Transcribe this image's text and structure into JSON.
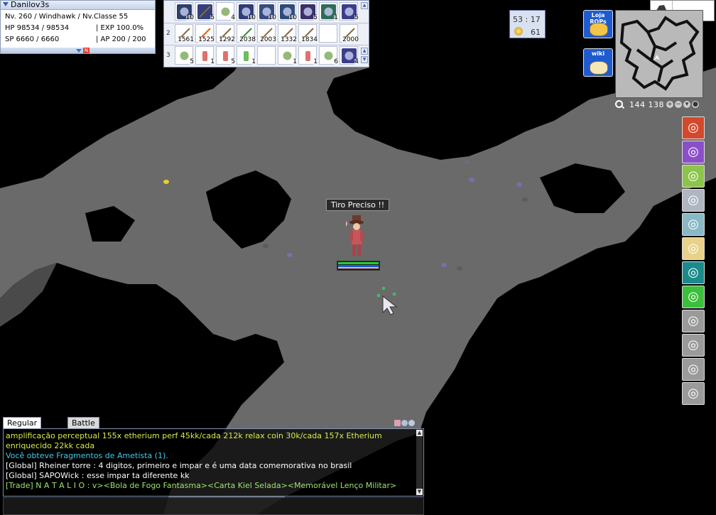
{
  "status": {
    "name": "Danilov3s",
    "level_line": "Nv. 260 / Windhawk / Nv.Classe 55",
    "hp": "HP 98534 / 98534",
    "exp": "| EXP 100.0%",
    "sp": "SP 6660 / 6660",
    "ap": "| AP 200 / 200",
    "badge": "N"
  },
  "hotkeys": {
    "rows": [
      {
        "num": "",
        "slots": [
          {
            "icon": "thunder-skill-icon",
            "color": "#2d3f6b",
            "count": "10"
          },
          {
            "icon": "arrow-skill-icon",
            "color": "#34407a",
            "count": "5"
          },
          {
            "icon": "stone-icon",
            "color": "#fff",
            "count": "4"
          },
          {
            "icon": "eye-skill-icon",
            "color": "#2f3c75",
            "count": "10"
          },
          {
            "icon": "ghost-skill-icon",
            "color": "#364c80",
            "count": "10"
          },
          {
            "icon": "trap-skill-icon",
            "color": "#2d4a78",
            "count": "10"
          },
          {
            "icon": "blade-skill-icon",
            "color": "#3a2f6b",
            "count": "5"
          },
          {
            "icon": "wind-skill-icon",
            "color": "#2f6b58",
            "count": "1"
          },
          {
            "icon": "storm-skill-icon",
            "color": "#3b3d8a",
            "count": "5"
          }
        ]
      },
      {
        "num": "2",
        "slots": [
          {
            "icon": "arrow-item-icon",
            "color": "#fff",
            "count": "1561"
          },
          {
            "icon": "fire-arrow-icon",
            "color": "#fff",
            "count": "1525"
          },
          {
            "icon": "arrow-item-icon",
            "color": "#fff",
            "count": "1292"
          },
          {
            "icon": "green-arrow-icon",
            "color": "#fff",
            "count": "2038"
          },
          {
            "icon": "arrow-item-icon",
            "color": "#fff",
            "count": "2003"
          },
          {
            "icon": "arrow-item-icon",
            "color": "#fff",
            "count": "1332"
          },
          {
            "icon": "arrow-item-icon",
            "color": "#fff",
            "count": "1834"
          },
          {
            "icon": "",
            "color": "#fff",
            "count": ""
          },
          {
            "icon": "arrow-item-icon",
            "color": "#fff",
            "count": "2000"
          }
        ]
      },
      {
        "num": "3",
        "slots": [
          {
            "icon": "leaf-icon",
            "color": "#fff",
            "count": "5"
          },
          {
            "icon": "potion-icon",
            "color": "#fff",
            "count": "1"
          },
          {
            "icon": "potion-icon",
            "color": "#fff",
            "count": "5"
          },
          {
            "icon": "flask-icon",
            "color": "#fff",
            "count": "1"
          },
          {
            "icon": "",
            "color": "#fff",
            "count": ""
          },
          {
            "icon": "clover-icon",
            "color": "#fff",
            "count": "1"
          },
          {
            "icon": "potion-icon",
            "color": "#fff",
            "count": "1"
          },
          {
            "icon": "fruit-icon",
            "color": "#fff",
            "count": "6"
          },
          {
            "icon": "book-icon",
            "color": "#3b3d8a",
            "count": "4"
          }
        ]
      }
    ]
  },
  "timebox": {
    "time": "53 : 17",
    "coins": "61"
  },
  "buttons": {
    "loja": "Loja ROPs",
    "wiki": "wiki"
  },
  "eqslot": {
    "count": "4"
  },
  "coords": {
    "xy": "144  138"
  },
  "overlay": {
    "skill_call": "Tiro Preciso !!"
  },
  "chat": {
    "tab_regular": "Regular Chat",
    "tab_battle": "Battle Log",
    "lines": [
      {
        "text": "amplificação perceptual 155x etherium perf 45kk/cada 212k relax coin 30k/cada 157x Etherium",
        "color": "#d9e94b"
      },
      {
        "text": "enriquecido 22kk cada",
        "color": "#d9e94b"
      },
      {
        "text": "Você obteve Fragmentos de Ametista (1).",
        "color": "#44c9e8"
      },
      {
        "text": "[Global] Rheiner torre : 4 digitos, primeiro e impar e é uma data comemorativa no brasil",
        "color": "#ffffff"
      },
      {
        "text": "[Global] SAPOWick : esse impar ta diferente kk",
        "color": "#ffffff"
      },
      {
        "text": "[Trade] N A T A L I O : v><Bola de Fogo Fantasma><Carta Kiel Selada><Memorável Lenço Militar>",
        "color": "#9fe36b"
      }
    ]
  },
  "skills_right": [
    {
      "icon": "fire-spiral-skill-icon",
      "color": "#d4482c"
    },
    {
      "icon": "purple-spiral-skill-icon",
      "color": "#8a4fc8"
    },
    {
      "icon": "green-swirl-skill-icon",
      "color": "#8dc44c"
    },
    {
      "icon": "white-swirl-skill-icon",
      "color": "#b0b6c0"
    },
    {
      "icon": "teal-swirl-skill-icon",
      "color": "#8ab8c4"
    },
    {
      "icon": "light-skill-icon",
      "color": "#e8d28a"
    },
    {
      "icon": "cross-arrows-skill-icon",
      "color": "#1a8a8c"
    },
    {
      "icon": "green-wing-skill-icon",
      "color": "#3cbf3c"
    },
    {
      "icon": "grey-skill-icon",
      "color": "#9a9a9a"
    },
    {
      "icon": "grey-skill-icon",
      "color": "#9a9a9a"
    },
    {
      "icon": "grey-skill-icon",
      "color": "#9a9a9a"
    },
    {
      "icon": "grey-skill-icon",
      "color": "#9a9a9a"
    }
  ]
}
